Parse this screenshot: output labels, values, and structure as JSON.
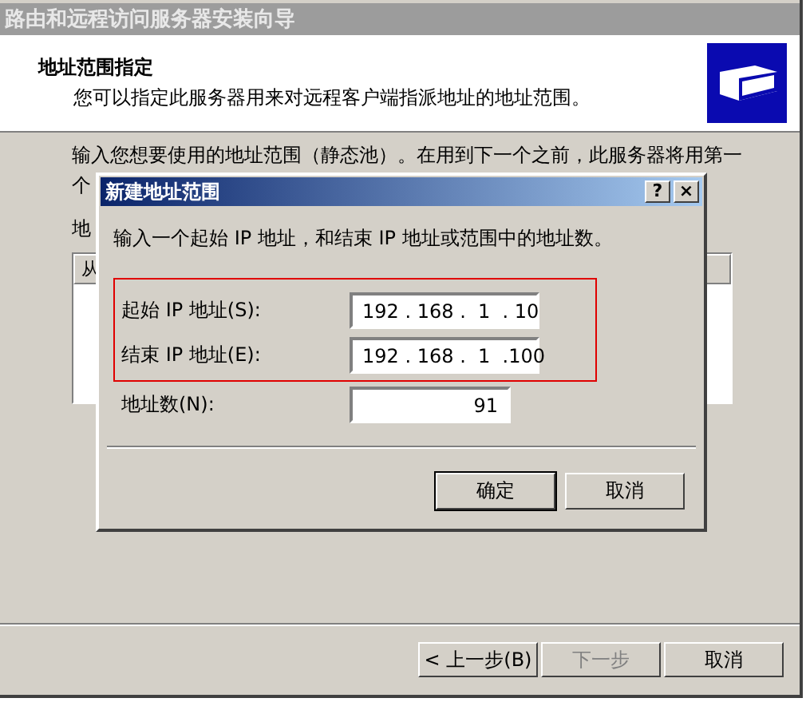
{
  "wizard": {
    "title": "路由和远程访问服务器安装向导",
    "header": {
      "heading": "地址范围指定",
      "subtitle": "您可以指定此服务器用来对远程客户端指派地址的地址范围。"
    },
    "intro": "输入您想要使用的地址范围（静态池）。在用到下一个之前，此服务器将用第一",
    "intro_cont": "个",
    "list_label": "地",
    "list_column": "从",
    "buttons": [
      {
        "label": "< 上一步(B)",
        "disabled": false
      },
      {
        "label": "下一步",
        "disabled": true
      },
      {
        "label": "取消",
        "disabled": false
      }
    ]
  },
  "dialog": {
    "title": "新建地址范围",
    "help": "?",
    "close": "×",
    "instruction": "输入一个起始 IP 地址，和结束 IP 地址或范围中的地址数。",
    "highlight_frame": true,
    "fields": [
      {
        "label": "起始 IP 地址(S):",
        "value": "192 . 168 .  1  . 10"
      },
      {
        "label": "结束 IP 地址(E):",
        "value": "192 . 168 .  1  .100"
      },
      {
        "label": "地址数(N):",
        "value": "91"
      }
    ],
    "buttons": [
      {
        "label": "确定",
        "default": true
      },
      {
        "label": "取消",
        "default": false
      }
    ]
  }
}
